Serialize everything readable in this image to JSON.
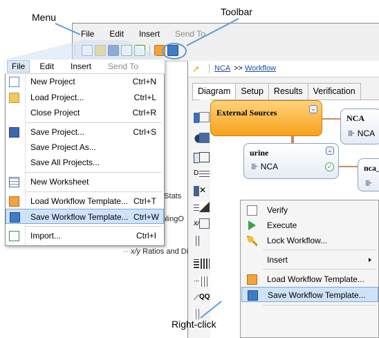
{
  "callouts": {
    "menu": "Menu",
    "toolbar": "Toolbar",
    "right_click": "Right-click"
  },
  "bg_menubar": {
    "file": "File",
    "edit": "Edit",
    "insert": "Insert",
    "send_to": "Send To"
  },
  "breadcrumb": {
    "first": "NCA",
    "separator": ">>",
    "second": "Workflow"
  },
  "tabs": [
    "Diagram",
    "Setup",
    "Results",
    "Verification"
  ],
  "tree": {
    "line1": "e Stats",
    "line2": "nplingO",
    "line3": "Ratios and Differ"
  },
  "nodes": {
    "external_sources": "External Sources",
    "nca_top": "NCA",
    "nca_top_sub": "NCA",
    "urine": "urine",
    "urine_sub": "NCA",
    "nca_right": "nca_"
  },
  "file_menu": {
    "bar": {
      "file": "File",
      "edit": "Edit",
      "insert": "Insert",
      "send_to": "Send To"
    },
    "items": [
      {
        "label": "New Project",
        "shortcut": "Ctrl+N",
        "icon": "new-project-icon"
      },
      {
        "label": "Load Project...",
        "shortcut": "Ctrl+L",
        "icon": "folder-icon"
      },
      {
        "label": "Close Project",
        "shortcut": "Ctrl+R",
        "icon": ""
      },
      {
        "label": "Save Project...",
        "shortcut": "Ctrl+S",
        "icon": "disk-icon"
      },
      {
        "label": "Save Project As...",
        "shortcut": "",
        "icon": ""
      },
      {
        "label": "Save All Projects...",
        "shortcut": "",
        "icon": ""
      },
      {
        "label": "New Worksheet",
        "shortcut": "",
        "icon": "worksheet-icon"
      },
      {
        "label": "Load Workflow Template...",
        "shortcut": "Ctrl+T",
        "icon": "load-workflow-template-icon"
      },
      {
        "label": "Save Workflow Template...",
        "shortcut": "Ctrl+W",
        "icon": "save-workflow-template-icon"
      },
      {
        "label": "Import...",
        "shortcut": "Ctrl+I",
        "icon": "import-icon"
      }
    ]
  },
  "context_menu": {
    "items": [
      {
        "label": "Verify",
        "icon": "verify-icon"
      },
      {
        "label": "Execute",
        "icon": "execute-icon"
      },
      {
        "label": "Lock Workflow...",
        "icon": "key-icon"
      },
      {
        "label": "Insert",
        "icon": ""
      },
      {
        "label": "Load Workflow Template...",
        "icon": "load-workflow-template-icon"
      },
      {
        "label": "Save Workflow Template...",
        "icon": "save-workflow-template-icon"
      }
    ]
  },
  "colors": {
    "highlight": "#cfe3f8",
    "highlight_border": "#7aa8d8",
    "external_sources_node": "#f7a21b",
    "link": "#1a4fa0",
    "callout_line": "#5b9bd5"
  }
}
